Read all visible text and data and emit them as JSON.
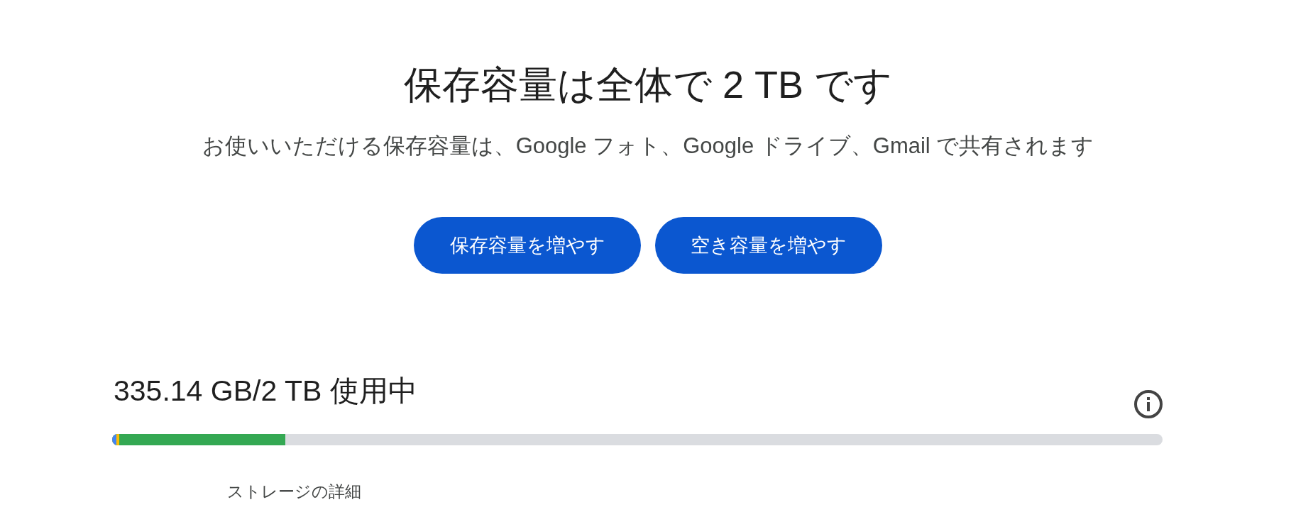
{
  "title": "保存容量は全体で 2 TB です",
  "subtitle": "お使いいただける保存容量は、Google フォト、Google ドライブ、Gmail で共有されます",
  "buttons": [
    "保存容量を増やす",
    "空き容量を増やす"
  ],
  "usage": {
    "label": "335.14 GB/2 TB 使用中",
    "segments": [
      {
        "color": "#4285f4",
        "level": 0.004
      },
      {
        "color": "#fbbc04",
        "level": 0.007
      },
      {
        "color": "#34a853",
        "level": 0.165
      }
    ]
  },
  "details_link": "ストレージの詳細"
}
